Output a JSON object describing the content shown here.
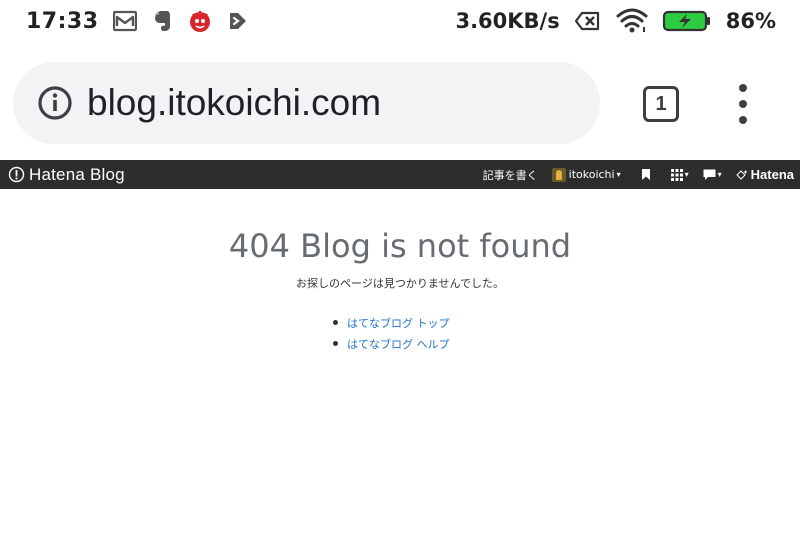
{
  "status_bar": {
    "time": "17:33",
    "net_speed": "3.60KB/s",
    "battery": "86%",
    "left_icons": [
      "gmail-icon",
      "evernote-icon",
      "antutu-icon",
      "pushbullet-icon"
    ],
    "right_icons": [
      "sim-off-icon",
      "wifi-icon",
      "battery-charging-icon"
    ],
    "battery_color": "#2ecc40"
  },
  "browser": {
    "url": "blog.itokoichi.com",
    "tab_count": "1",
    "omnibox_bg": "#f1f3f4"
  },
  "hatena_header": {
    "brand": "Hatena Blog",
    "write_label": "記事を書く",
    "username": "itokoichi",
    "hatena_label": "Hatena",
    "bg": "#2d2d2d"
  },
  "content": {
    "title": "404 Blog is not found",
    "message": "お探しのページは見つかりませんでした。",
    "links": [
      {
        "label": "はてなブログ トップ"
      },
      {
        "label": "はてなブログ ヘルプ"
      }
    ],
    "link_color": "#2373c5"
  }
}
